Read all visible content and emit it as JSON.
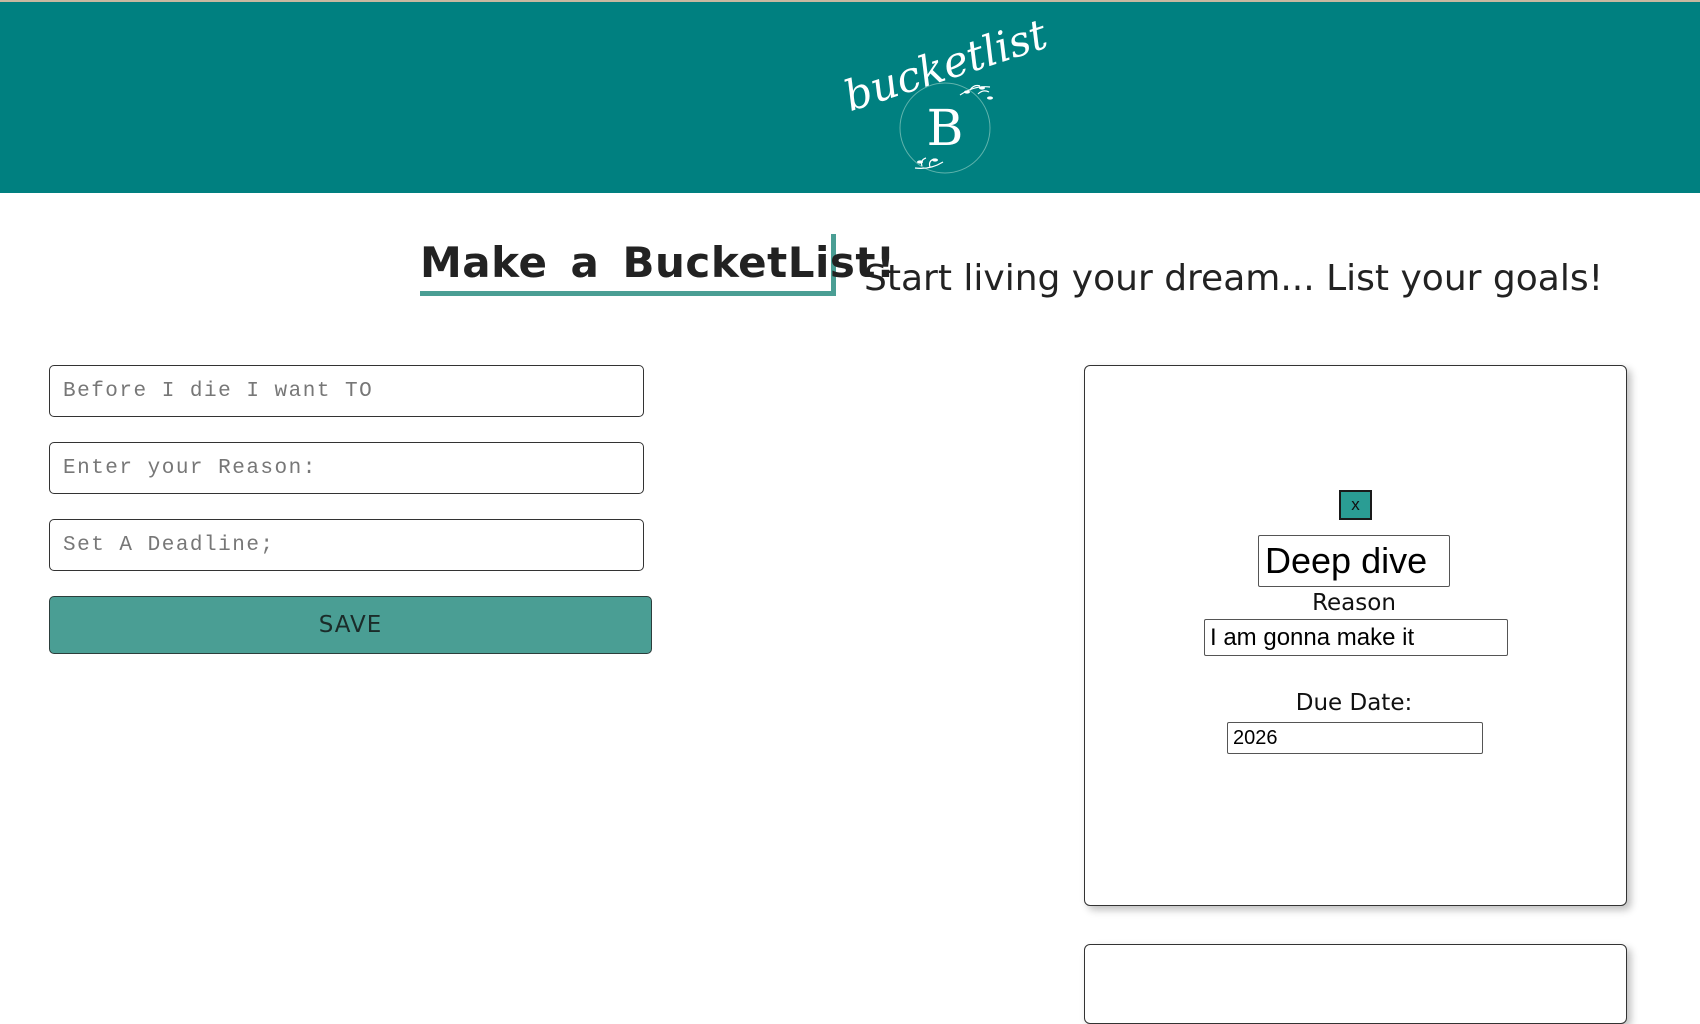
{
  "header": {
    "logo_script_text": "bucketlist",
    "logo_letter": "B",
    "background_color": "#008080"
  },
  "hero": {
    "headline": "Make a BucketList!",
    "tagline": "Start living your dream... List your goals!"
  },
  "form": {
    "goal_placeholder": "Before I die I want TO",
    "reason_placeholder": "Enter your Reason:",
    "deadline_placeholder": "Set A Deadline;",
    "save_label": "SAVE",
    "accent_color": "#4a9e94"
  },
  "cards": [
    {
      "close_label": "x",
      "goal": "Deep dive",
      "reason_label": "Reason",
      "reason": "I am gonna make it",
      "due_label": "Due Date:",
      "due": "2026"
    }
  ]
}
